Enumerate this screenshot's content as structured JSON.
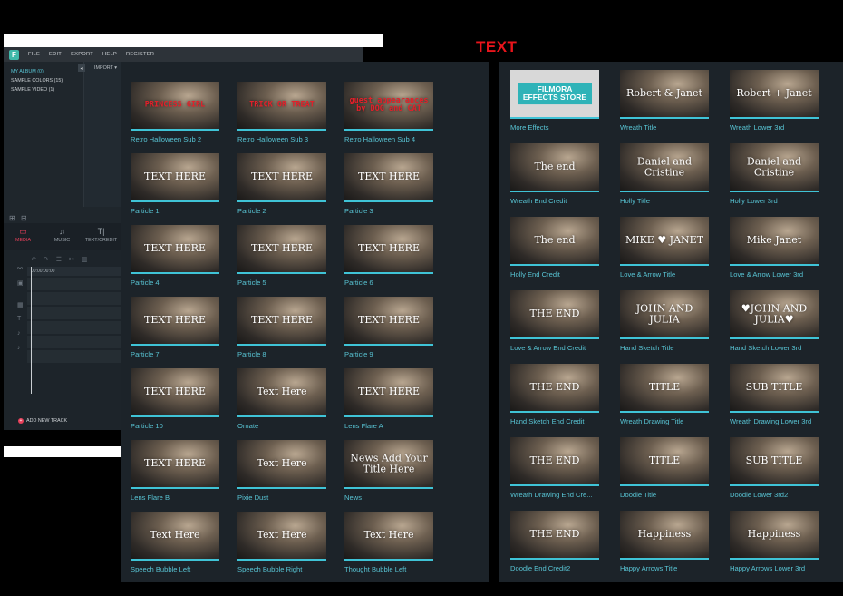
{
  "banner": "TEXT",
  "editor": {
    "logo": "F",
    "menu": [
      "FILE",
      "EDIT",
      "EXPORT",
      "HELP",
      "REGISTER"
    ],
    "album": [
      "MY ALBUM (0)",
      "SAMPLE COLORS (15)",
      "SAMPLE VIDEO (1)"
    ],
    "import_label": "IMPORT",
    "tabs": [
      {
        "icon": "media-icon",
        "label": "MEDIA"
      },
      {
        "icon": "music-icon",
        "label": "MUSIC"
      },
      {
        "icon": "text-icon",
        "label": "TEXT/CREDIT"
      }
    ],
    "timecode": "00:00:00:00",
    "add_track": "ADD NEW TRACK"
  },
  "center_grid": [
    {
      "label": "Retro Halloween Sub 2",
      "overlay": "PRINCESS GIRL"
    },
    {
      "label": "Retro Halloween Sub 3",
      "overlay": "TRICK OR TREAT"
    },
    {
      "label": "Retro Halloween Sub 4",
      "overlay": "guest appearances by DOG and CAT"
    },
    {
      "label": "Particle 1",
      "overlay": "TEXT HERE"
    },
    {
      "label": "Particle 2",
      "overlay": "TEXT HERE"
    },
    {
      "label": "Particle 3",
      "overlay": "TEXT HERE"
    },
    {
      "label": "Particle 4",
      "overlay": "TEXT HERE"
    },
    {
      "label": "Particle 5",
      "overlay": "TEXT HERE"
    },
    {
      "label": "Particle 6",
      "overlay": "TEXT HERE"
    },
    {
      "label": "Particle 7",
      "overlay": "TEXT HERE"
    },
    {
      "label": "Particle 8",
      "overlay": "TEXT HERE"
    },
    {
      "label": "Particle 9",
      "overlay": "TEXT HERE"
    },
    {
      "label": "Particle 10",
      "overlay": "TEXT HERE"
    },
    {
      "label": "Ornate",
      "overlay": "Text Here"
    },
    {
      "label": "Lens Flare A",
      "overlay": "TEXT HERE"
    },
    {
      "label": "Lens Flare B",
      "overlay": "TEXT HERE"
    },
    {
      "label": "Pixie Dust",
      "overlay": "Text Here"
    },
    {
      "label": "News",
      "overlay": "News Add Your Title Here"
    },
    {
      "label": "Speech Bubble Left",
      "overlay": "Text Here"
    },
    {
      "label": "Speech Bubble Right",
      "overlay": "Text Here"
    },
    {
      "label": "Thought Bubble Left",
      "overlay": "Text Here"
    }
  ],
  "right_grid": [
    {
      "label": "More Effects",
      "overlay": "FILMORA EFFECTS STORE"
    },
    {
      "label": "Wreath Title",
      "overlay": "Robert & Janet"
    },
    {
      "label": "Wreath Lower 3rd",
      "overlay": "Robert + Janet"
    },
    {
      "label": "Wreath End Credit",
      "overlay": "The end"
    },
    {
      "label": "Holly Title",
      "overlay": "Daniel and Cristine"
    },
    {
      "label": "Holly Lower 3rd",
      "overlay": "Daniel and Cristine"
    },
    {
      "label": "Holly End Credit",
      "overlay": "The end"
    },
    {
      "label": "Love & Arrow Title",
      "overlay": "MIKE ♥ JANET"
    },
    {
      "label": "Love & Arrow Lower 3rd",
      "overlay": "Mike Janet"
    },
    {
      "label": "Love & Arrow End Credit",
      "overlay": "THE END"
    },
    {
      "label": "Hand Sketch Title",
      "overlay": "JOHN AND JULIA"
    },
    {
      "label": "Hand Sketch Lower 3rd",
      "overlay": "♥JOHN AND JULIA♥"
    },
    {
      "label": "Hand Sketch End Credit",
      "overlay": "THE END"
    },
    {
      "label": "Wreath Drawing Title",
      "overlay": "TITLE"
    },
    {
      "label": "Wreath Drawing Lower 3rd",
      "overlay": "SUB TITLE"
    },
    {
      "label": "Wreath Drawing End Cre...",
      "overlay": "THE END"
    },
    {
      "label": "Doodle Title",
      "overlay": "TITLE"
    },
    {
      "label": "Doodle Lower 3rd2",
      "overlay": "SUB TITLE"
    },
    {
      "label": "Doodle End Credit2",
      "overlay": "THE END"
    },
    {
      "label": "Happy Arrows Title",
      "overlay": "Happiness"
    },
    {
      "label": "Happy Arrows Lower 3rd",
      "overlay": "Happiness"
    }
  ]
}
